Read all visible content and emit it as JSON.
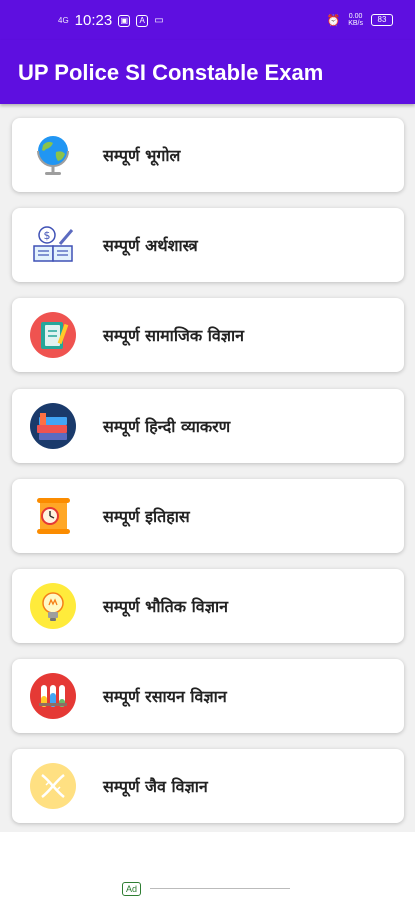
{
  "status_bar": {
    "signal_text": "4G",
    "time": "10:23",
    "net_speed_value": "0.00",
    "net_speed_unit": "KB/s",
    "battery": "83"
  },
  "app_bar": {
    "title": "UP Police SI Constable Exam"
  },
  "menu": {
    "items": [
      {
        "label": "सम्पूर्ण भूगोल",
        "icon": "globe-icon"
      },
      {
        "label": "सम्पूर्ण अर्थशास्त्र",
        "icon": "economics-icon"
      },
      {
        "label": "सम्पूर्ण सामाजिक विज्ञान",
        "icon": "notebook-icon"
      },
      {
        "label": " सम्पूर्ण हिन्दी व्याकरण",
        "icon": "books-icon"
      },
      {
        "label": "सम्पूर्ण इतिहास",
        "icon": "scroll-clock-icon"
      },
      {
        "label": "सम्पूर्ण भौतिक विज्ञान",
        "icon": "lightbulb-icon"
      },
      {
        "label": "सम्पूर्ण रसायन विज्ञान",
        "icon": "test-tubes-icon"
      },
      {
        "label": "सम्पूर्ण जैव विज्ञान",
        "icon": "dna-icon"
      }
    ]
  },
  "ad": {
    "badge": "Ad"
  },
  "colors": {
    "primary": "#5e0fe0",
    "card_bg": "#ffffff",
    "page_bg": "#f1f1f1"
  }
}
